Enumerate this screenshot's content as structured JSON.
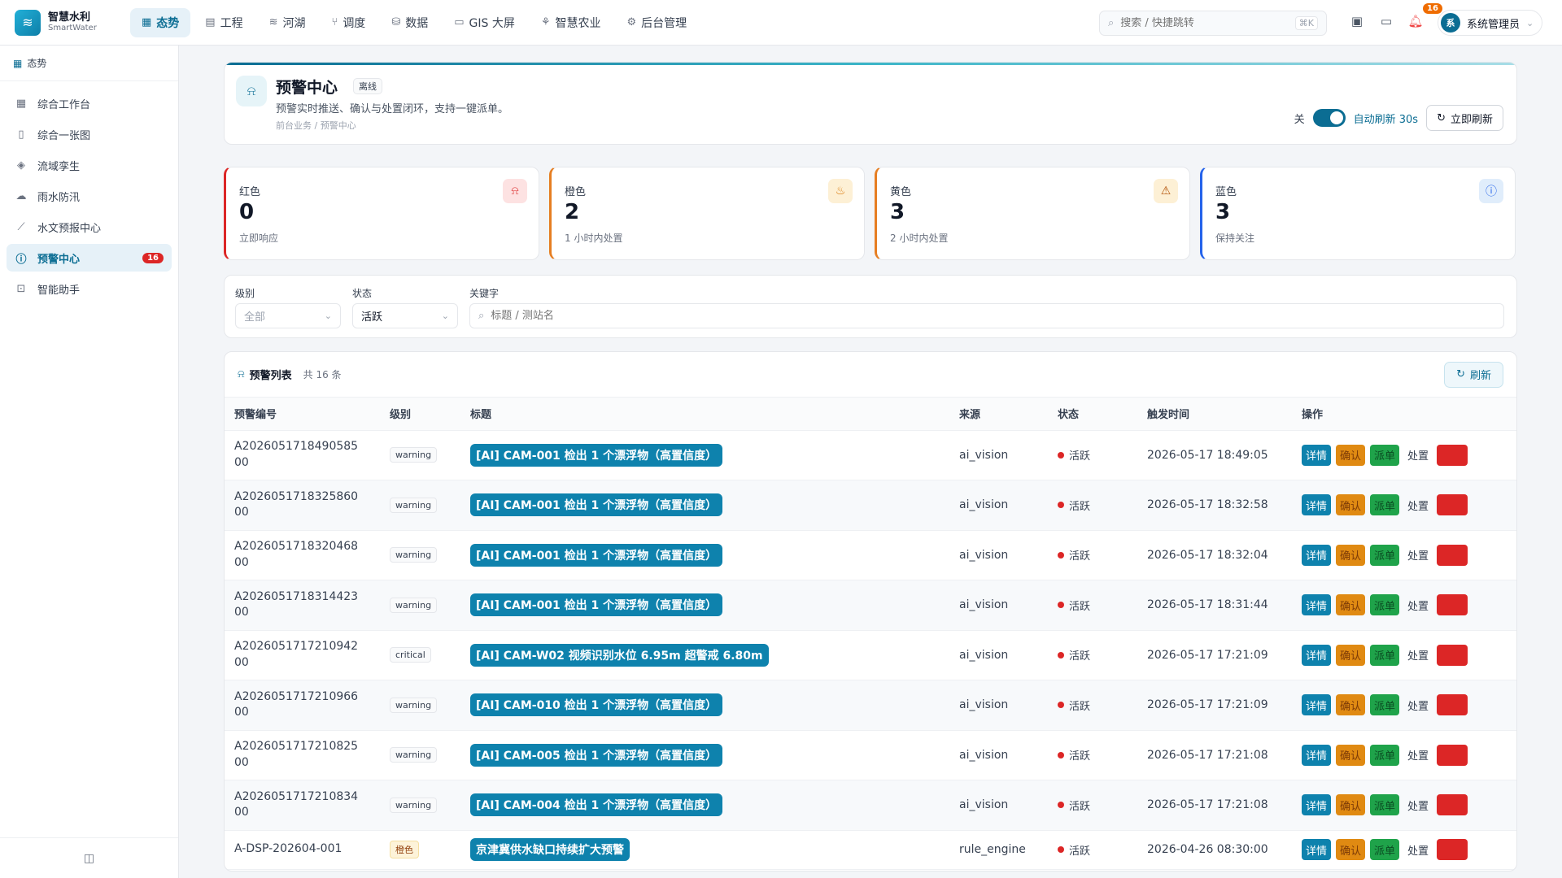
{
  "brand": {
    "name": "智慧水利",
    "sub": "SmartWater"
  },
  "nav": [
    {
      "label": "态势",
      "icon": "grid-icon"
    },
    {
      "label": "工程",
      "icon": "building-icon"
    },
    {
      "label": "河湖",
      "icon": "waves-icon"
    },
    {
      "label": "调度",
      "icon": "route-icon"
    },
    {
      "label": "数据",
      "icon": "database-icon"
    },
    {
      "label": "GIS 大屏",
      "icon": "monitor-icon"
    },
    {
      "label": "智慧农业",
      "icon": "sprout-icon"
    },
    {
      "label": "后台管理",
      "icon": "gear-icon"
    }
  ],
  "search": {
    "placeholder": "搜索 / 快捷跳转",
    "shortcut": "⌘K"
  },
  "notifications": {
    "count": "16"
  },
  "user": {
    "avatar": "系",
    "name": "系统管理员"
  },
  "sidebar": {
    "header": "态势",
    "items": [
      {
        "label": "综合工作台"
      },
      {
        "label": "综合一张图"
      },
      {
        "label": "流域孪生"
      },
      {
        "label": "雨水防汛"
      },
      {
        "label": "水文预报中心"
      },
      {
        "label": "预警中心",
        "badge": "16"
      },
      {
        "label": "智能助手"
      }
    ]
  },
  "page": {
    "title": "预警中心",
    "tag": "离线",
    "desc": "预警实时推送、确认与处置闭环，支持一键派单。",
    "breadcrumb": "前台业务 / 预警中心",
    "toggle_off_label": "关",
    "auto_refresh_label": "自动刷新 30s",
    "refresh_now_label": "立即刷新"
  },
  "stats": [
    {
      "label": "红色",
      "value": "0",
      "sub": "立即响应",
      "color": "#dc2626",
      "icon_bg": "#fde2e2"
    },
    {
      "label": "橙色",
      "value": "2",
      "sub": "1 小时内处置",
      "color": "#e67e22",
      "icon_bg": "#fdf0d5"
    },
    {
      "label": "黄色",
      "value": "3",
      "sub": "2 小时内处置",
      "color": "#e67e22",
      "icon_bg": "#fdf0d5"
    },
    {
      "label": "蓝色",
      "value": "3",
      "sub": "保持关注",
      "color": "#2563eb",
      "icon_bg": "#e0edfb"
    }
  ],
  "filters": {
    "level_label": "级别",
    "level_value": "全部",
    "status_label": "状态",
    "status_value": "活跃",
    "keyword_label": "关键字",
    "keyword_placeholder": "标题 / 测站名"
  },
  "list": {
    "title": "预警列表",
    "count": "共 16 条",
    "refresh_label": "刷新",
    "columns": [
      "预警编号",
      "级别",
      "标题",
      "来源",
      "状态",
      "触发时间",
      "操作"
    ],
    "ops": {
      "detail": "详情",
      "confirm": "确认",
      "dispatch": "派单",
      "handle": "处置"
    },
    "rows": [
      {
        "code": "A202605171849058500",
        "level": "warning",
        "title": "[AI] CAM-001 检出 1 个漂浮物（高置信度）",
        "source": "ai_vision",
        "status": "活跃",
        "time": "2026-05-17 18:49:05"
      },
      {
        "code": "A202605171832586000",
        "level": "warning",
        "title": "[AI] CAM-001 检出 1 个漂浮物（高置信度）",
        "source": "ai_vision",
        "status": "活跃",
        "time": "2026-05-17 18:32:58"
      },
      {
        "code": "A202605171832046800",
        "level": "warning",
        "title": "[AI] CAM-001 检出 1 个漂浮物（高置信度）",
        "source": "ai_vision",
        "status": "活跃",
        "time": "2026-05-17 18:32:04"
      },
      {
        "code": "A202605171831442300",
        "level": "warning",
        "title": "[AI] CAM-001 检出 1 个漂浮物（高置信度）",
        "source": "ai_vision",
        "status": "活跃",
        "time": "2026-05-17 18:31:44"
      },
      {
        "code": "A202605171721094200",
        "level": "critical",
        "title": "[AI] CAM-W02 视频识别水位 6.95m 超警戒 6.80m",
        "source": "ai_vision",
        "status": "活跃",
        "time": "2026-05-17 17:21:09"
      },
      {
        "code": "A202605171721096600",
        "level": "warning",
        "title": "[AI] CAM-010 检出 1 个漂浮物（高置信度）",
        "source": "ai_vision",
        "status": "活跃",
        "time": "2026-05-17 17:21:09"
      },
      {
        "code": "A202605171721082500",
        "level": "warning",
        "title": "[AI] CAM-005 检出 1 个漂浮物（高置信度）",
        "source": "ai_vision",
        "status": "活跃",
        "time": "2026-05-17 17:21:08"
      },
      {
        "code": "A202605171721083400",
        "level": "warning",
        "title": "[AI] CAM-004 检出 1 个漂浮物（高置信度）",
        "source": "ai_vision",
        "status": "活跃",
        "time": "2026-05-17 17:21:08"
      },
      {
        "code": "A-DSP-202604-001",
        "level": "橙色",
        "title": "京津冀供水缺口持续扩大预警",
        "source": "rule_engine",
        "status": "活跃",
        "time": "2026-04-26 08:30:00"
      }
    ]
  }
}
